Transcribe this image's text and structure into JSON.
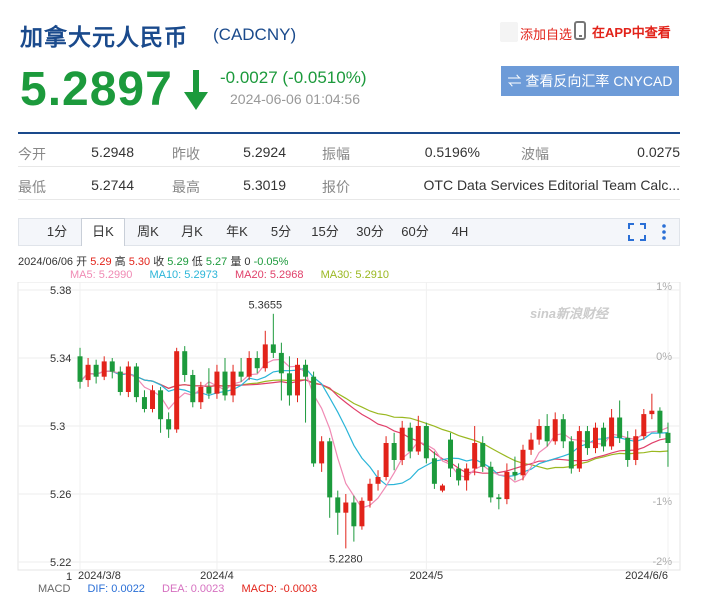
{
  "header": {
    "name": "加拿大元人民币",
    "code": "(CADCNY)",
    "fav_label": "添加自选",
    "app_label": "在APP中查看"
  },
  "quote": {
    "price": "5.2897",
    "change": "-0.0027 (-0.0510%)",
    "timestamp": "2024-06-06 01:04:56",
    "reverse_button": "⇌ 查看反向汇率 CNYCAD",
    "down_color": "#1c9a3c"
  },
  "stats": {
    "row1": [
      {
        "label": "今开",
        "value": "5.2948"
      },
      {
        "label": "昨收",
        "value": "5.2924"
      },
      {
        "label": "振幅",
        "value": "0.5196%"
      },
      {
        "label": "波幅",
        "value": "0.0275"
      }
    ],
    "row2": [
      {
        "label": "最低",
        "value": "5.2744"
      },
      {
        "label": "最高",
        "value": "5.3019"
      },
      {
        "label": "报价",
        "value": "OTC Data Services Editorial Team Calc..."
      }
    ]
  },
  "tabs": [
    "1分",
    "日K",
    "周K",
    "月K",
    "年K",
    "5分",
    "15分",
    "30分",
    "60分",
    "4H"
  ],
  "active_tab": "日K",
  "chart_info": {
    "date": "2024/06/06",
    "open_label": "开",
    "open": "5.29",
    "high_label": "高",
    "high": "5.30",
    "close_label": "收",
    "close": "5.29",
    "low_label": "低",
    "low": "5.27",
    "vol_label": "量",
    "vol": "0",
    "pct": "-0.05%"
  },
  "ma_legend": [
    {
      "label": "MA5: 5.2990",
      "color": "#f08ab4"
    },
    {
      "label": "MA10: 5.2973",
      "color": "#2bb5d8"
    },
    {
      "label": "MA20: 5.2968",
      "color": "#e0406a"
    },
    {
      "label": "MA30: 5.2910",
      "color": "#9ab820"
    }
  ],
  "macd_legend": [
    {
      "label": "MACD",
      "color": "#666"
    },
    {
      "label": "DIF: 0.0022",
      "color": "#2a6fd6"
    },
    {
      "label": "DEA: 0.0023",
      "color": "#d670c0"
    },
    {
      "label": "MACD: -0.0003",
      "color": "#e2231a"
    }
  ],
  "macd_axis_top": "1",
  "watermark": "sina新浪财经",
  "chart_data": {
    "type": "candlestick",
    "ylim": [
      5.22,
      5.38
    ],
    "y_ticks": [
      "5.38",
      "5.34",
      "5.3",
      "5.26",
      "5.22"
    ],
    "y_tick_values": [
      5.38,
      5.34,
      5.3,
      5.26,
      5.22
    ],
    "right_ticks": [
      "1%",
      "0%",
      "-1%",
      "-2%"
    ],
    "right_tick_values": [
      5.3453,
      5.3924,
      5.3395,
      5.2866
    ],
    "x_ticks": [
      "2024/3/8",
      "2024/4",
      "2024/5",
      "2024/6/6"
    ],
    "x_tick_index": [
      0,
      17,
      43,
      73
    ],
    "annotations": [
      {
        "text": "5.3655",
        "index": 23,
        "value": 5.3655
      },
      {
        "text": "5.2280",
        "index": 33,
        "value": 5.228
      }
    ],
    "up_color": "#e2231a",
    "down_color": "#1c9a3c",
    "candles": [
      [
        5.341,
        5.326,
        5.346,
        5.322
      ],
      [
        5.327,
        5.336,
        5.34,
        5.323
      ],
      [
        5.336,
        5.329,
        5.339,
        5.325
      ],
      [
        5.329,
        5.338,
        5.341,
        5.327
      ],
      [
        5.338,
        5.332,
        5.34,
        5.328
      ],
      [
        5.332,
        5.32,
        5.335,
        5.318
      ],
      [
        5.32,
        5.335,
        5.338,
        5.317
      ],
      [
        5.335,
        5.317,
        5.337,
        5.314
      ],
      [
        5.317,
        5.31,
        5.321,
        5.308
      ],
      [
        5.31,
        5.321,
        5.324,
        5.308
      ],
      [
        5.321,
        5.304,
        5.323,
        5.296
      ],
      [
        5.304,
        5.298,
        5.308,
        5.293
      ],
      [
        5.298,
        5.344,
        5.346,
        5.296
      ],
      [
        5.344,
        5.33,
        5.347,
        5.326
      ],
      [
        5.33,
        5.314,
        5.333,
        5.311
      ],
      [
        5.314,
        5.323,
        5.326,
        5.31
      ],
      [
        5.323,
        5.319,
        5.334,
        5.316
      ],
      [
        5.319,
        5.332,
        5.336,
        5.316
      ],
      [
        5.332,
        5.318,
        5.34,
        5.315
      ],
      [
        5.318,
        5.332,
        5.336,
        5.314
      ],
      [
        5.332,
        5.329,
        5.34,
        5.326
      ],
      [
        5.329,
        5.34,
        5.344,
        5.327
      ],
      [
        5.34,
        5.334,
        5.344,
        5.331
      ],
      [
        5.334,
        5.348,
        5.356,
        5.332
      ],
      [
        5.348,
        5.343,
        5.366,
        5.34
      ],
      [
        5.343,
        5.331,
        5.349,
        5.315
      ],
      [
        5.331,
        5.318,
        5.341,
        5.312
      ],
      [
        5.318,
        5.336,
        5.34,
        5.314
      ],
      [
        5.336,
        5.329,
        5.339,
        5.302
      ],
      [
        5.329,
        5.278,
        5.332,
        5.276
      ],
      [
        5.278,
        5.291,
        5.294,
        5.273
      ],
      [
        5.291,
        5.258,
        5.293,
        5.246
      ],
      [
        5.258,
        5.249,
        5.262,
        5.236
      ],
      [
        5.249,
        5.255,
        5.26,
        5.228
      ],
      [
        5.255,
        5.241,
        5.259,
        5.232
      ],
      [
        5.241,
        5.256,
        5.258,
        5.239
      ],
      [
        5.256,
        5.266,
        5.269,
        5.252
      ],
      [
        5.266,
        5.27,
        5.274,
        5.262
      ],
      [
        5.27,
        5.29,
        5.294,
        5.268
      ],
      [
        5.29,
        5.28,
        5.296,
        5.274
      ],
      [
        5.28,
        5.299,
        5.303,
        5.277
      ],
      [
        5.299,
        5.285,
        5.302,
        5.281
      ],
      [
        5.285,
        5.3,
        5.306,
        5.283
      ],
      [
        5.3,
        5.281,
        5.302,
        5.278
      ],
      [
        5.281,
        5.266,
        5.285,
        5.263
      ],
      [
        5.262,
        5.265,
        5.266,
        5.261
      ],
      [
        5.292,
        5.275,
        5.296,
        5.27
      ],
      [
        5.275,
        5.268,
        5.278,
        5.265
      ],
      [
        5.268,
        5.275,
        5.278,
        5.262
      ],
      [
        5.275,
        5.29,
        5.3,
        5.271
      ],
      [
        5.29,
        5.276,
        5.294,
        5.273
      ],
      [
        5.276,
        5.258,
        5.279,
        5.255
      ],
      [
        5.258,
        5.257,
        5.26,
        5.251
      ],
      [
        5.257,
        5.273,
        5.278,
        5.254
      ],
      [
        5.273,
        5.271,
        5.282,
        5.268
      ],
      [
        5.271,
        5.286,
        5.289,
        5.268
      ],
      [
        5.286,
        5.292,
        5.296,
        5.283
      ],
      [
        5.292,
        5.3,
        5.304,
        5.289
      ],
      [
        5.3,
        5.291,
        5.307,
        5.288
      ],
      [
        5.291,
        5.304,
        5.308,
        5.289
      ],
      [
        5.304,
        5.291,
        5.307,
        5.287
      ],
      [
        5.291,
        5.275,
        5.294,
        5.272
      ],
      [
        5.275,
        5.297,
        5.3,
        5.273
      ],
      [
        5.297,
        5.287,
        5.3,
        5.283
      ],
      [
        5.287,
        5.299,
        5.302,
        5.284
      ],
      [
        5.299,
        5.288,
        5.302,
        5.285
      ],
      [
        5.288,
        5.305,
        5.31,
        5.286
      ],
      [
        5.305,
        5.293,
        5.315,
        5.29
      ],
      [
        5.293,
        5.28,
        5.297,
        5.276
      ],
      [
        5.28,
        5.294,
        5.298,
        5.277
      ],
      [
        5.294,
        5.307,
        5.31,
        5.292
      ],
      [
        5.307,
        5.309,
        5.319,
        5.304
      ],
      [
        5.309,
        5.296,
        5.311,
        5.293
      ],
      [
        5.296,
        5.29,
        5.302,
        5.276
      ]
    ]
  }
}
